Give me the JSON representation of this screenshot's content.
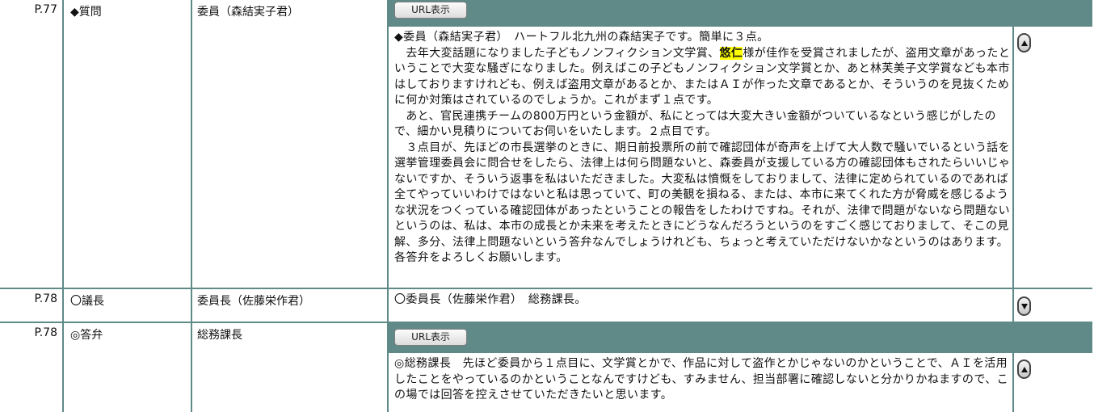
{
  "url_button_label": "URL表示",
  "rows": [
    {
      "page": "P.77",
      "type": "◆質問",
      "speaker": "委員（森結実子君）",
      "body": {
        "p1": "◆委員（森結実子君）　ハートフル北九州の森結実子です。簡単に３点。",
        "p2_before": "　去年大変話題になりました子どもノンフィクション文学賞、",
        "p2_highlight": "悠仁",
        "p2_after": "様が佳作を受賞されましたが、盗用文章があったということで大変な騒ぎになりました。例えばこの子どもノンフィクション文学賞とか、あと林芙美子文学賞なども本市はしておりますけれども、例えば盗用文章があるとか、またはＡＩが作った文章であるとか、そういうのを見抜くために何か対策はされているのでしょうか。これがまず１点です。",
        "p3": "　あと、官民連携チームの800万円という金額が、私にとっては大変大きい金額がついているなという感じがしたので、細かい見積りについてお伺いをいたします。２点目です。",
        "p4": "　３点目が、先ほどの市長選挙のときに、期日前投票所の前で確認団体が奇声を上げて大人数で騒いでいるという話を選挙管理委員会に問合せをしたら、法律上は何ら問題ないと、森委員が支援している方の確認団体もされたらいいじゃないですか、そういう返事を私はいただきました。大変私は憤慨をしておりまして、法律に定められているのであれば全てやっていいわけではないと私は思っていて、町の美観を損ねる、または、本市に来てくれた方が脅威を感じるような状況をつくっている確認団体があったということの報告をしたわけですね。それが、法律で問題がないなら問題ないというのは、私は、本市の成長とか未来を考えたときにどうなんだろうというのをすごく感じておりまして、そこの見解、多分、法律上問題ないという答弁なんでしょうけれども、ちょっと考えていただけないかなというのはあります。各答弁をよろしくお願いします。"
      }
    },
    {
      "page": "P.78",
      "type": "〇議長",
      "speaker": "委員長（佐藤栄作君）",
      "body": "〇委員長（佐藤栄作君）　総務課長。"
    },
    {
      "page": "P.78",
      "type": "◎答弁",
      "speaker": "総務課長",
      "body": "◎総務課長　先ほど委員から１点目に、文学賞とかで、作品に対して盗作とかじゃないのかということで、ＡＩを活用したことをやっているのかということなんですけども、すみません、担当部署に確認しないと分かりかねますので、この場では回答を控えさせていただきたいと思います。"
    }
  ]
}
